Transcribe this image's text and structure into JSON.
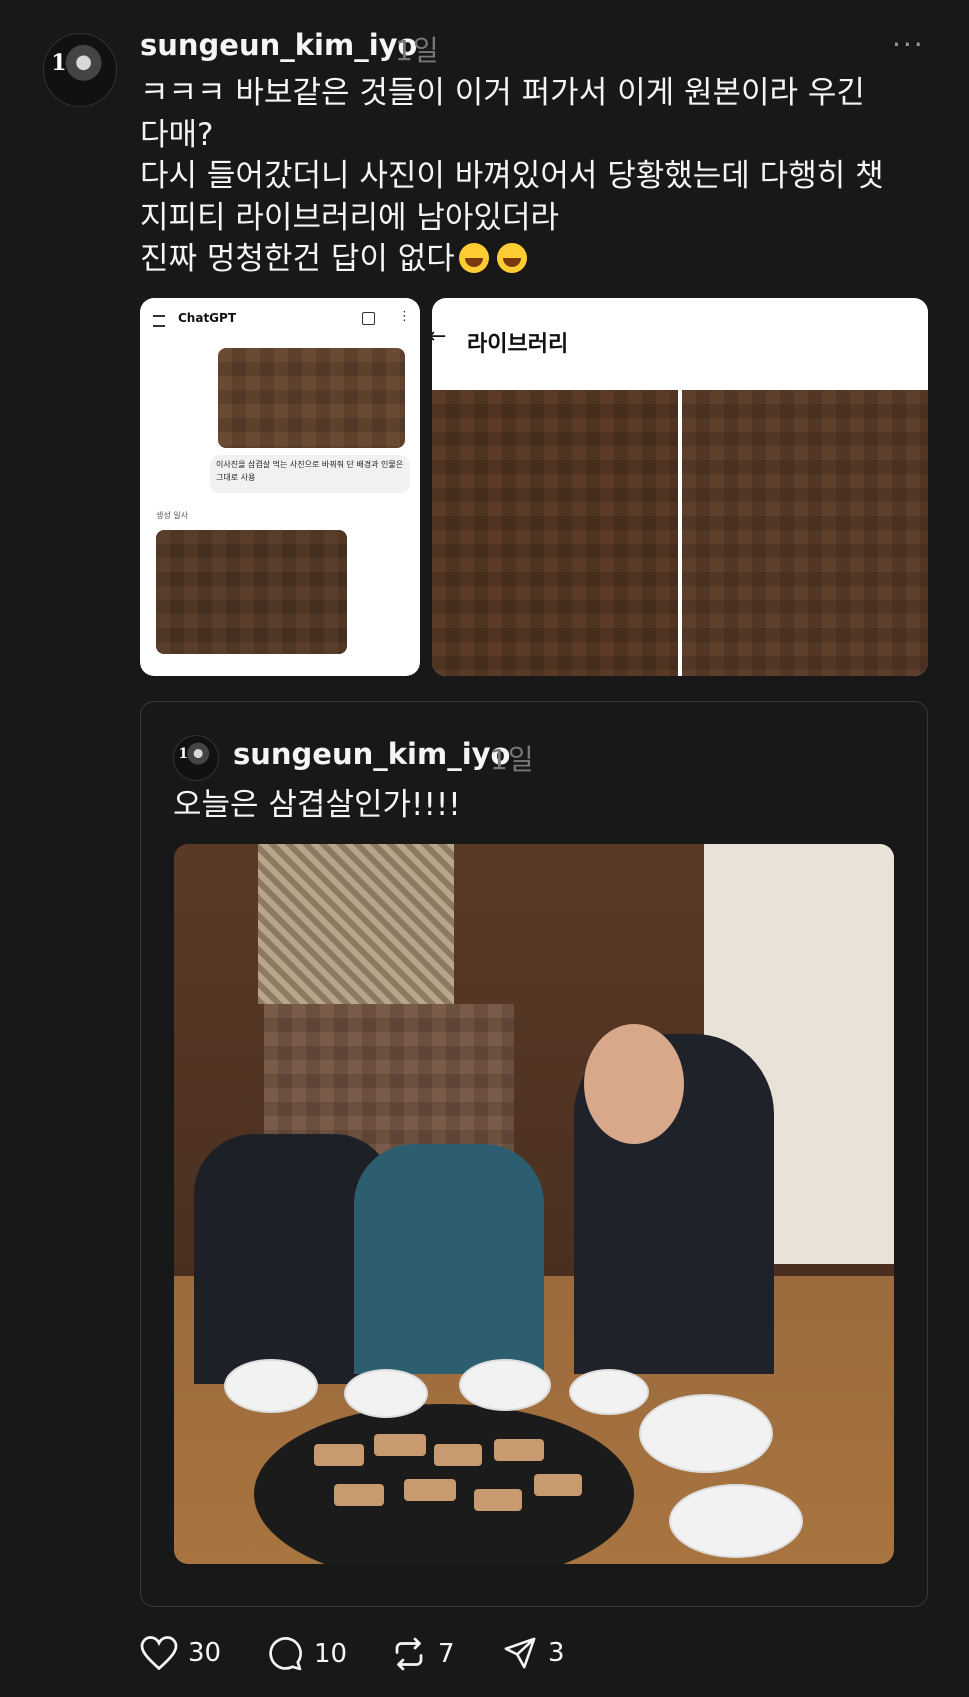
{
  "post": {
    "username": "sungeun_kim_iyo",
    "time": "1일",
    "more": "···",
    "lines": [
      "ㅋㅋㅋ 바보같은 것들이 이거 퍼가서 이게 원본이라 우긴",
      "다매?",
      "다시 들어갔더니 사진이 바껴있어서 당황했는데 다행히 챗",
      "지피티 라이브러리에 남아있더라",
      "진짜 멍청한건 답이 없다"
    ]
  },
  "screenshot_left": {
    "app_title": "ChatGPT",
    "prompt": "이사진을 삼겹살 먹는 사진으로 바꿔줘 단 배경과 인물은 그대로 사용",
    "generated_label": "생성 일사"
  },
  "screenshot_right": {
    "back": "←",
    "title": "라이브러리"
  },
  "quote": {
    "username": "sungeun_kim_iyo",
    "time": "1일",
    "text": "오늘은 삼겹살인가!!!!"
  },
  "actions": {
    "likes": "30",
    "comments": "10",
    "reposts": "7",
    "shares": "3"
  },
  "colors": {
    "background": "#181818",
    "text": "#f3f5f7",
    "muted": "#777777",
    "border": "#3a3a3a"
  }
}
